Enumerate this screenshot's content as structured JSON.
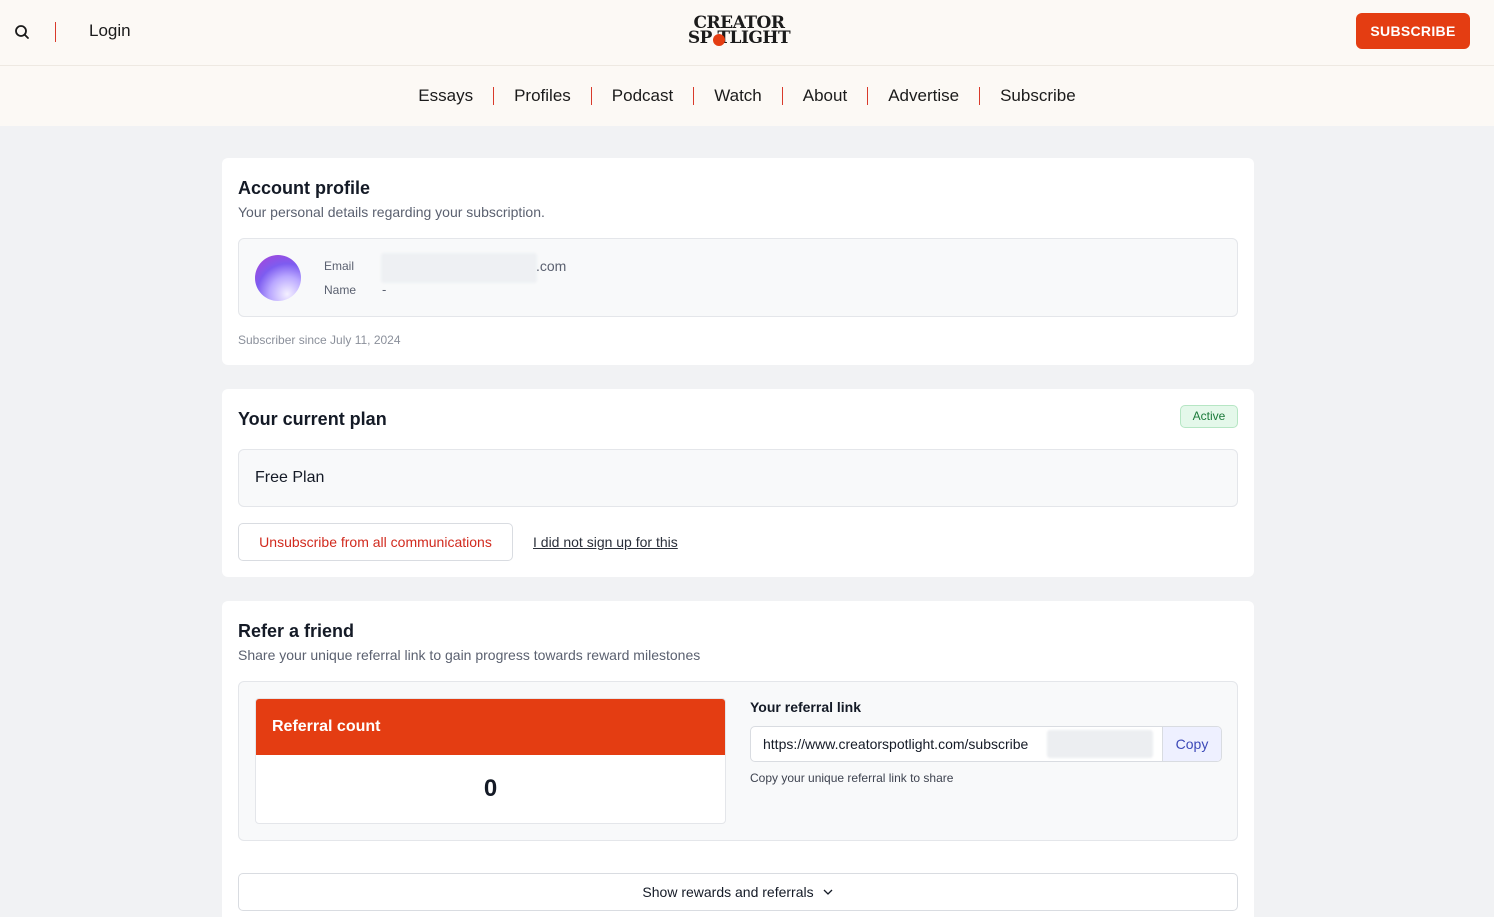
{
  "header": {
    "login_label": "Login",
    "logo_line1": "CREATOR",
    "logo_line2": "SP TLIGHT",
    "subscribe_label": "SUBSCRIBE"
  },
  "nav": {
    "items": [
      "Essays",
      "Profiles",
      "Podcast",
      "Watch",
      "About",
      "Advertise",
      "Subscribe"
    ]
  },
  "account": {
    "title": "Account profile",
    "subtitle": "Your personal details regarding your subscription.",
    "email_label": "Email",
    "email_value_visible": ".com",
    "name_label": "Name",
    "name_value": "-",
    "since": "Subscriber since July 11, 2024"
  },
  "plan": {
    "title": "Your current plan",
    "status": "Active",
    "plan_name": "Free Plan",
    "unsubscribe_label": "Unsubscribe from all communications",
    "not_signed_up_label": "I did not sign up for this"
  },
  "referral": {
    "title": "Refer a friend",
    "subtitle": "Share your unique referral link to gain progress towards reward milestones",
    "count_label": "Referral count",
    "count_value": "0",
    "link_label": "Your referral link",
    "link_value": "https://www.creatorspotlight.com/subscribe",
    "copy_label": "Copy",
    "link_help": "Copy your unique referral link to share",
    "show_rewards_label": "Show rewards and referrals"
  },
  "colors": {
    "brand": "#e43d12",
    "page_bg": "#f1f2f4",
    "header_bg": "#fcf9f5",
    "active_badge": "#1b7a3a",
    "danger_text": "#d12a1e",
    "copy_text": "#3c49b8"
  }
}
